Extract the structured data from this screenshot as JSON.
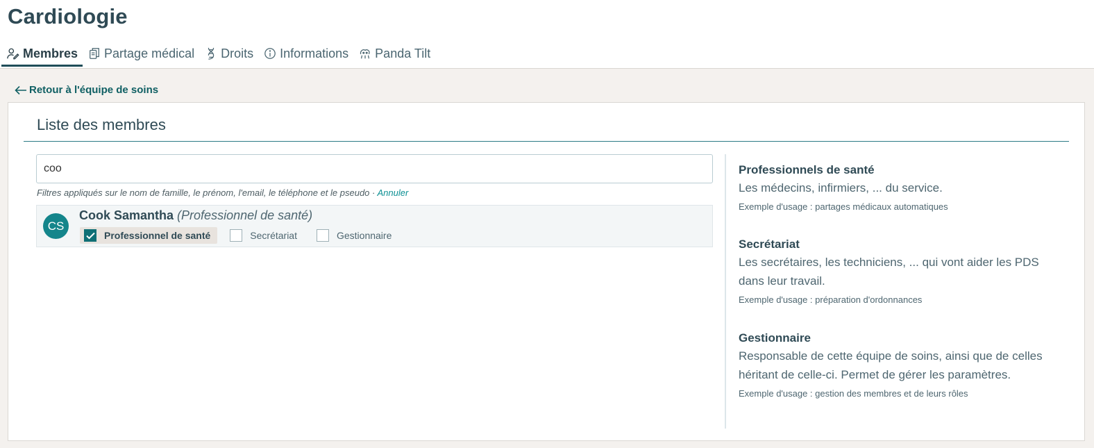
{
  "header": {
    "title": "Cardiologie"
  },
  "tabs": [
    {
      "label": "Membres",
      "icon": "user-edit-icon",
      "active": true
    },
    {
      "label": "Partage médical",
      "icon": "documents-icon",
      "active": false
    },
    {
      "label": "Droits",
      "icon": "dna-icon",
      "active": false
    },
    {
      "label": "Informations",
      "icon": "info-circle-icon",
      "active": false
    },
    {
      "label": "Panda Tilt",
      "icon": "panda-icon",
      "active": false
    }
  ],
  "back_link": {
    "label": "Retour à l'équipe de soins"
  },
  "panel": {
    "title": "Liste des membres"
  },
  "search": {
    "value": "coo",
    "placeholder": ""
  },
  "filter_note": {
    "text": "Filtres appliqués sur le nom de famille, le prénom, l'email, le téléphone et le pseudo · ",
    "cancel": "Annuler"
  },
  "members": [
    {
      "initials": "CS",
      "name": "Cook Samantha",
      "role_label": "(Professionnel de santé)",
      "roles": [
        {
          "label": "Professionnel de santé",
          "checked": true
        },
        {
          "label": "Secrétariat",
          "checked": false
        },
        {
          "label": "Gestionnaire",
          "checked": false
        }
      ]
    }
  ],
  "descriptions": [
    {
      "title": "Professionnels de santé",
      "text": "Les médecins, infirmiers, ... du service.",
      "example": "Exemple d'usage : partages médicaux automatiques"
    },
    {
      "title": "Secrétariat",
      "text": "Les secrétaires, les techniciens, ... qui vont aider les PDS dans leur travail.",
      "example": "Exemple d'usage : préparation d'ordonnances"
    },
    {
      "title": "Gestionnaire",
      "text": "Responsable de cette équipe de soins, ainsi que de celles héritant de celle-ci. Permet de gérer les paramètres.",
      "example": "Exemple d'usage : gestion des membres et de leurs rôles"
    }
  ],
  "colors": {
    "accent": "#0f6f75",
    "avatar": "#14858b",
    "link": "#0b8f93",
    "rule": "#2b7a85"
  }
}
